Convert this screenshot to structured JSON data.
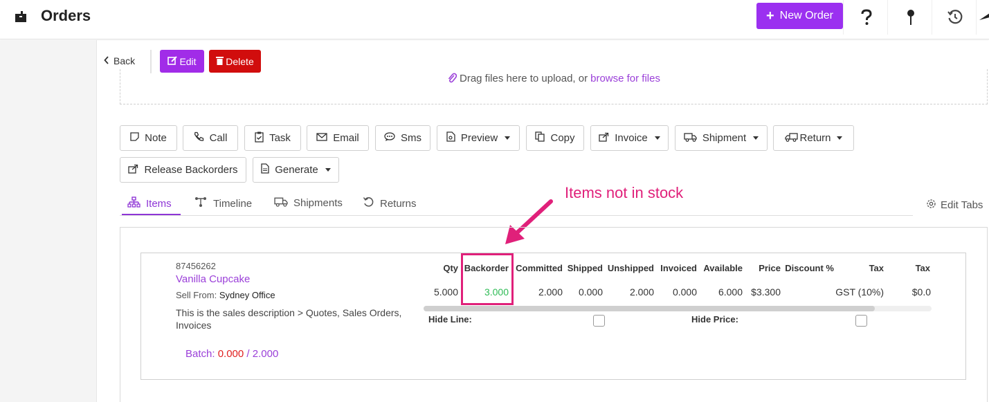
{
  "header": {
    "title": "Orders",
    "new_order_label": "New Order",
    "new_order_color": "#9b30f0"
  },
  "toolbar": {
    "back_label": "Back",
    "edit_label": "Edit",
    "delete_label": "Delete"
  },
  "upload": {
    "text": "Drag files here to upload, or",
    "link": "browse for files"
  },
  "actions": [
    {
      "label": "Note",
      "icon": "note-icon"
    },
    {
      "label": "Call",
      "icon": "phone-icon"
    },
    {
      "label": "Task",
      "icon": "clipboard-icon"
    },
    {
      "label": "Email",
      "icon": "envelope-icon"
    },
    {
      "label": "Sms",
      "icon": "sms-icon"
    },
    {
      "label": "Preview",
      "icon": "preview-icon",
      "dropdown": true
    },
    {
      "label": "Copy",
      "icon": "copy-icon"
    },
    {
      "label": "Invoice",
      "icon": "share-icon",
      "dropdown": true
    },
    {
      "label": "Shipment",
      "icon": "truck-icon",
      "dropdown": true
    },
    {
      "label": "Return",
      "icon": "return-truck-icon",
      "dropdown": true
    },
    {
      "label": "Release Backorders",
      "icon": "share-icon"
    },
    {
      "label": "Generate",
      "icon": "document-icon",
      "dropdown": true
    }
  ],
  "tabs": [
    {
      "label": "Items",
      "icon": "sitemap-icon",
      "active": true
    },
    {
      "label": "Timeline",
      "icon": "timeline-icon"
    },
    {
      "label": "Shipments",
      "icon": "truck-icon"
    },
    {
      "label": "Returns",
      "icon": "undo-icon"
    }
  ],
  "edit_tabs_label": "Edit Tabs",
  "annotation": {
    "text": "Items not in stock",
    "color": "#e0207a"
  },
  "item": {
    "sku": "87456262",
    "name": "Vanilla Cupcake",
    "sell_from_label": "Sell From:",
    "sell_from_value": "Sydney Office",
    "description": "This is the sales description > Quotes, Sales Orders, Invoices",
    "batch_label": "Batch:",
    "batch_value": "0.000",
    "batch_total": "/ 2.000",
    "columns": [
      "Qty",
      "Backorder",
      "Committed",
      "Shipped",
      "Unshipped",
      "Invoiced",
      "Available",
      "Price",
      "Discount %",
      "Tax",
      "Tax"
    ],
    "values": [
      "5.000",
      "3.000",
      "2.000",
      "0.000",
      "2.000",
      "0.000",
      "6.000",
      "$3.300",
      "",
      "GST (10%)",
      "$0.0"
    ],
    "hide_line_label": "Hide Line:",
    "hide_price_label": "Hide Price:"
  }
}
